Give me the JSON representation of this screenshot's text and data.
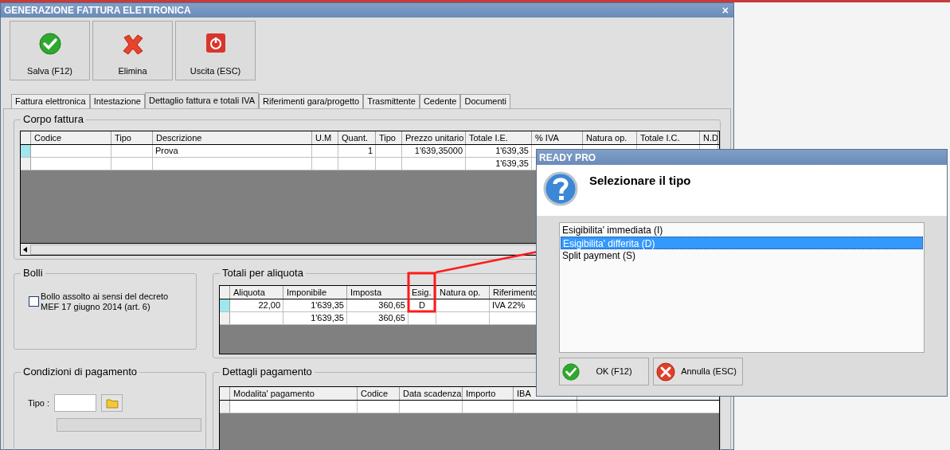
{
  "window": {
    "title": "GENERAZIONE FATTURA ELETTRONICA",
    "close": "×"
  },
  "toolbar": [
    {
      "kind": "save",
      "label": "Salva (F12)"
    },
    {
      "kind": "delete",
      "label": "Elimina"
    },
    {
      "kind": "exit",
      "label": "Uscita (ESC)"
    }
  ],
  "tabs": [
    {
      "label": "Fattura elettronica",
      "selected": false
    },
    {
      "label": "Intestazione",
      "selected": false
    },
    {
      "label": "Dettaglio fattura e totali IVA",
      "selected": true
    },
    {
      "label": "Riferimenti gara/progetto",
      "selected": false
    },
    {
      "label": "Trasmittente",
      "selected": false
    },
    {
      "label": "Cedente",
      "selected": false
    },
    {
      "label": "Documenti",
      "selected": false
    }
  ],
  "corpo_fattura": {
    "title": "Corpo fattura",
    "columns": [
      "Codice",
      "Tipo",
      "Descrizione",
      "U.M",
      "Quant.",
      "Tipo",
      "Prezzo unitario",
      "Totale I.E.",
      "% IVA",
      "Natura op.",
      "Totale I.C.",
      "N.D"
    ],
    "rows": [
      {
        "selected": true,
        "cells": [
          "",
          "",
          "Prova",
          "",
          "1",
          "",
          "1'639,35000",
          "1'639,35",
          "",
          "",
          "",
          ""
        ]
      },
      {
        "selected": false,
        "cells": [
          "",
          "",
          "",
          "",
          "",
          "",
          "",
          "1'639,35",
          "",
          "",
          "",
          ""
        ]
      }
    ]
  },
  "bolli": {
    "title": "Bolli",
    "checkbox": {
      "label": "Bollo assolto ai sensi del decreto MEF 17 giugno 2014 (art. 6)",
      "checked": false
    }
  },
  "totali": {
    "title": "Totali per aliquota",
    "columns": [
      "Aliquota",
      "Imponibile",
      "Imposta",
      "Esig.",
      "Natura op.",
      "Riferimento"
    ],
    "rows": [
      {
        "selected": true,
        "cells": [
          "22,00",
          "1'639,35",
          "360,65",
          "D",
          "",
          "IVA 22%"
        ]
      },
      {
        "selected": false,
        "cells": [
          "",
          "1'639,35",
          "360,65",
          "",
          "",
          ""
        ]
      }
    ]
  },
  "condizioni": {
    "title": "Condizioni di pagamento",
    "tipo_label": "Tipo :"
  },
  "dettagli": {
    "title": "Dettagli pagamento",
    "columns": [
      "Modalita' pagamento",
      "Codice",
      "Data scadenza",
      "Importo",
      "IBA"
    ],
    "rows": [
      {
        "selected": false,
        "cells": [
          "",
          "",
          "",
          "",
          ""
        ]
      }
    ]
  },
  "dialog": {
    "title": "READY PRO",
    "heading": "Selezionare il tipo",
    "options": [
      {
        "label": "Esigibilita' immediata (I)",
        "selected": false
      },
      {
        "label": "Esigibilita' differita (D)",
        "selected": true
      },
      {
        "label": "Split payment (S)",
        "selected": false
      }
    ],
    "buttons": [
      {
        "kind": "ok",
        "label": "OK (F12)"
      },
      {
        "kind": "cancel",
        "label": "Annulla (ESC)"
      }
    ]
  }
}
